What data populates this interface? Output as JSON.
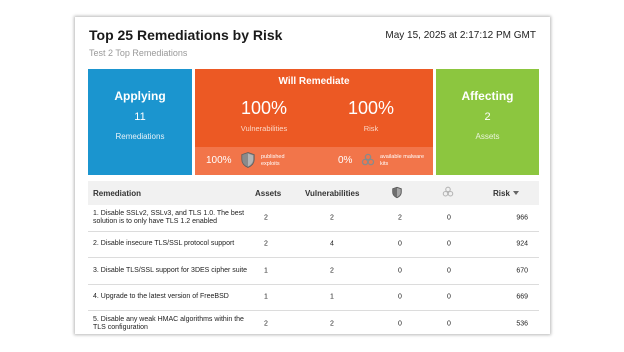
{
  "header": {
    "title": "Top 25 Remediations by Risk",
    "timestamp": "May 15, 2025 at 2:17:12 PM GMT",
    "subtitle": "Test 2 Top Remediations"
  },
  "tiles": {
    "applying": {
      "heading": "Applying",
      "value": "11",
      "label": "Remediations",
      "color": "#1b95cf"
    },
    "will_remediate": {
      "heading": "Will Remediate",
      "color": "#ec5924",
      "vulnerabilities_pct": "100%",
      "vulnerabilities_label": "Vulnerabilities",
      "risk_pct": "100%",
      "risk_label": "Risk",
      "published_exploits_pct": "100%",
      "published_exploits_label": "published exploits",
      "malware_kits_pct": "0%",
      "malware_kits_label": "available malware kits"
    },
    "affecting": {
      "heading": "Affecting",
      "value": "2",
      "label": "Assets",
      "color": "#8cc63f"
    }
  },
  "table": {
    "columns": {
      "remediation": "Remediation",
      "assets": "Assets",
      "vulnerabilities": "Vulnerabilities",
      "exploits_icon": "shield-icon",
      "malware_icon": "biohazard-icon",
      "risk": "Risk"
    },
    "rows": [
      {
        "remediation": "1. Disable SSLv2, SSLv3, and TLS 1.0. The best solution is to only have TLS 1.2 enabled",
        "assets": "2",
        "vulnerabilities": "2",
        "exploits": "2",
        "malware": "0",
        "risk": "966"
      },
      {
        "remediation": "2. Disable insecure TLS/SSL protocol support",
        "assets": "2",
        "vulnerabilities": "4",
        "exploits": "0",
        "malware": "0",
        "risk": "924"
      },
      {
        "remediation": "3. Disable TLS/SSL support for 3DES cipher suite",
        "assets": "1",
        "vulnerabilities": "2",
        "exploits": "0",
        "malware": "0",
        "risk": "670"
      },
      {
        "remediation": "4. Upgrade to the latest version of FreeBSD",
        "assets": "1",
        "vulnerabilities": "1",
        "exploits": "0",
        "malware": "0",
        "risk": "669"
      },
      {
        "remediation": "5. Disable any weak HMAC algorithms within the TLS configuration",
        "assets": "2",
        "vulnerabilities": "2",
        "exploits": "0",
        "malware": "0",
        "risk": "536"
      }
    ]
  }
}
